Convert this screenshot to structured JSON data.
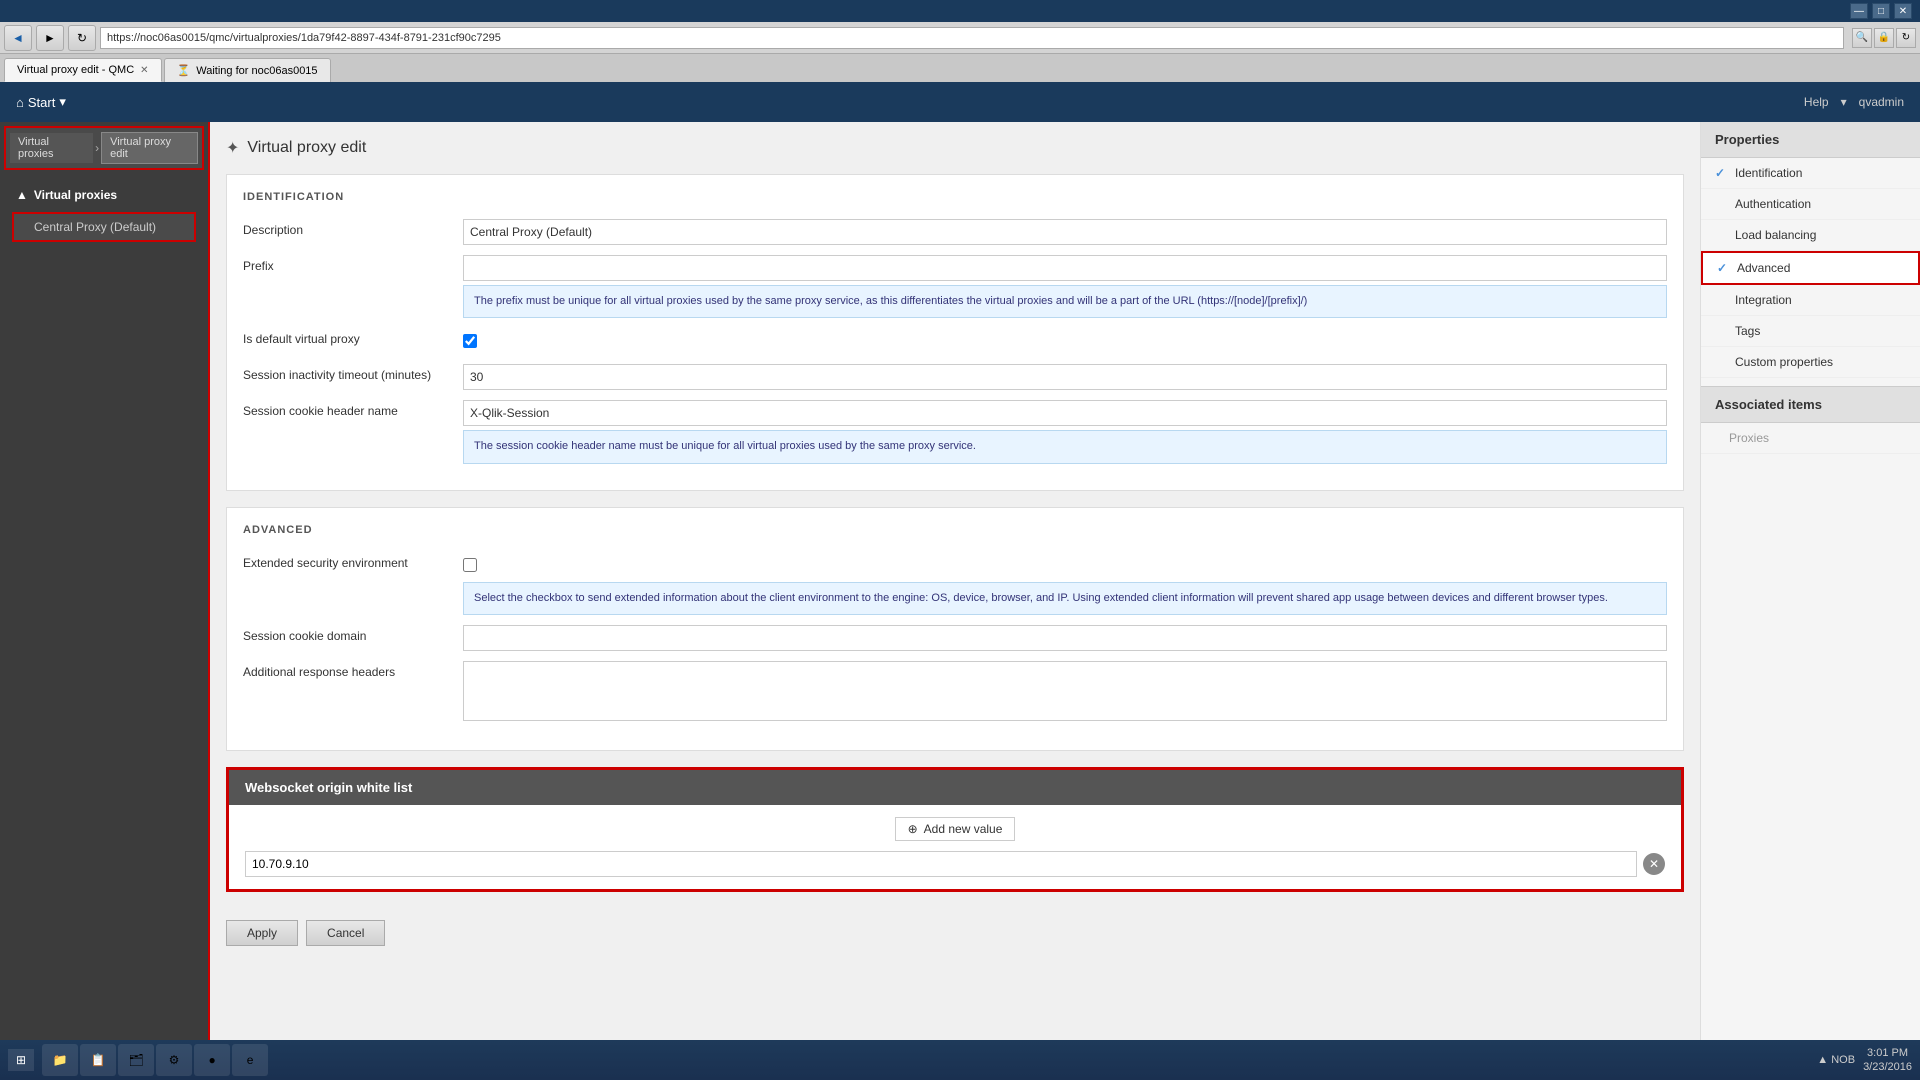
{
  "titlebar": {
    "controls": [
      "—",
      "□",
      "✕"
    ]
  },
  "browser": {
    "address": "https://noc06as0015/qmc/virtualproxies/1da79f42-8897-434f-8791-231cf90c7295",
    "tabs": [
      {
        "label": "Virtual proxy edit - QMC",
        "active": true,
        "closable": true
      },
      {
        "label": "Waiting for noc06as0015",
        "active": false,
        "closable": false
      }
    ],
    "nav_buttons": [
      "◄",
      "►",
      "↻"
    ]
  },
  "app_header": {
    "start_label": "Start",
    "help_label": "Help",
    "user_label": "qvadmin"
  },
  "sidebar": {
    "breadcrumbs": [
      {
        "label": "Virtual proxies"
      },
      {
        "label": "Virtual proxy edit"
      }
    ],
    "section_label": "Virtual proxies",
    "items": [
      {
        "label": "Central Proxy (Default)"
      }
    ]
  },
  "page": {
    "title": "Virtual proxy edit",
    "title_icon": "✦"
  },
  "identification": {
    "section_label": "IDENTIFICATION",
    "fields": [
      {
        "label": "Description",
        "value": "Central Proxy (Default)",
        "type": "text"
      },
      {
        "label": "Prefix",
        "value": "",
        "type": "text"
      },
      {
        "label": "",
        "value": "",
        "type": "hint",
        "hint": "The prefix must be unique for all virtual proxies used by the same proxy service, as this differentiates the virtual proxies and will be a part of the URL (https://[node]/[prefix]/)"
      },
      {
        "label": "Is default virtual proxy",
        "value": "",
        "type": "checkbox",
        "checked": true
      },
      {
        "label": "Session inactivity timeout (minutes)",
        "value": "30",
        "type": "text"
      },
      {
        "label": "Session cookie header name",
        "value": "X-Qlik-Session",
        "type": "text"
      },
      {
        "label": "",
        "value": "",
        "type": "hint",
        "hint": "The session cookie header name must be unique for all virtual proxies used by the same proxy service."
      }
    ]
  },
  "advanced": {
    "section_label": "ADVANCED",
    "fields": [
      {
        "label": "Extended security environment",
        "value": "",
        "type": "checkbox",
        "checked": false
      },
      {
        "label": "",
        "type": "hint",
        "hint": "Select the checkbox to send extended information about the client environment to the engine: OS, device, browser, and IP. Using extended client information will prevent shared app usage between devices and different browser types."
      },
      {
        "label": "Session cookie domain",
        "value": "",
        "type": "text"
      },
      {
        "label": "Additional response headers",
        "value": "",
        "type": "textarea"
      }
    ]
  },
  "websocket": {
    "title": "Websocket origin white list",
    "add_label": "Add new value",
    "add_icon": "⊕",
    "entries": [
      {
        "value": "10.70.9.10"
      }
    ],
    "delete_icon": "✕"
  },
  "properties_panel": {
    "title": "Properties",
    "items": [
      {
        "label": "Identification",
        "active": true,
        "checked": true
      },
      {
        "label": "Authentication",
        "active": false,
        "checked": false
      },
      {
        "label": "Load balancing",
        "active": false,
        "checked": false
      },
      {
        "label": "Advanced",
        "active": true,
        "checked": true,
        "highlighted": true
      },
      {
        "label": "Integration",
        "active": false,
        "checked": false
      },
      {
        "label": "Tags",
        "active": false,
        "checked": false
      },
      {
        "label": "Custom properties",
        "active": false,
        "checked": false
      }
    ],
    "associated_title": "Associated items",
    "associated_items": [
      {
        "label": "Proxies"
      }
    ]
  },
  "bottom_bar": {
    "apply_label": "Apply",
    "cancel_label": "Cancel"
  },
  "taskbar": {
    "start_label": "Start",
    "time": "3:01 PM",
    "date": "3/23/2016",
    "system_icons": [
      "▲",
      "NOB"
    ]
  }
}
